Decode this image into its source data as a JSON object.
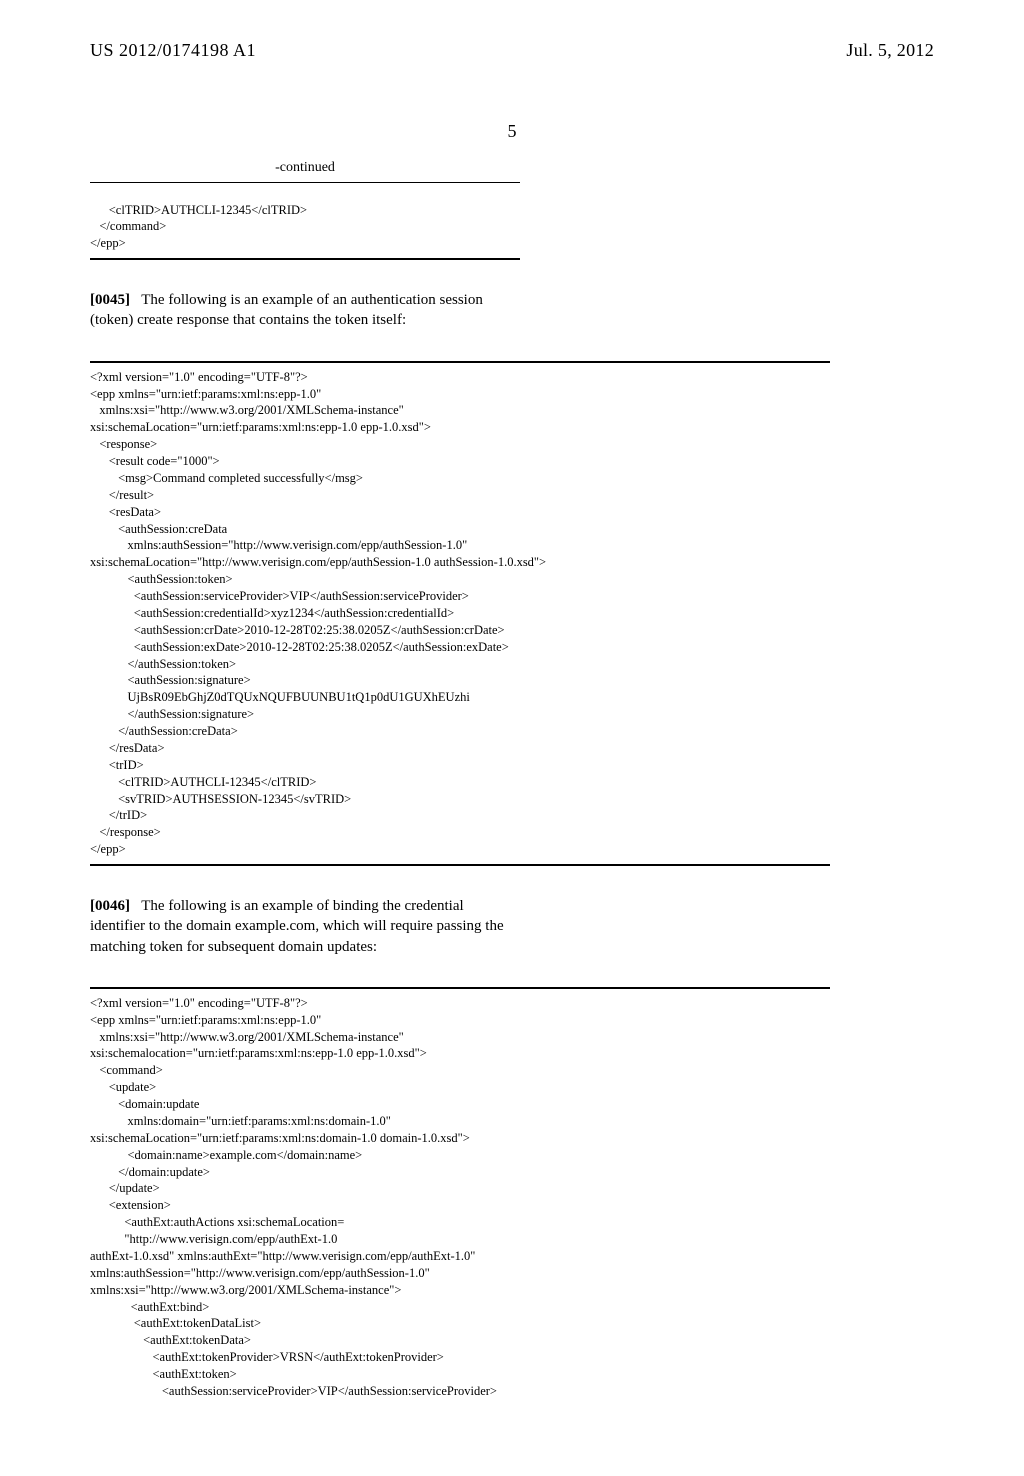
{
  "header": {
    "pub_number": "US 2012/0174198 A1",
    "pub_date": "Jul. 5, 2012"
  },
  "page_number": "5",
  "continued_label": "-continued",
  "code1": "      <clTRID>AUTHCLI-12345</clTRID>\n   </command>\n</epp>",
  "para1": {
    "num": "[0045]",
    "text": "The following is an example of an authentication session (token) create response that contains the token itself:"
  },
  "code2": "<?xml version=\"1.0\" encoding=\"UTF-8\"?>\n<epp xmlns=\"urn:ietf:params:xml:ns:epp-1.0\"\n   xmlns:xsi=\"http://www.w3.org/2001/XMLSchema-instance\"\nxsi:schemaLocation=\"urn:ietf:params:xml:ns:epp-1.0 epp-1.0.xsd\">\n   <response>\n      <result code=\"1000\">\n         <msg>Command completed successfully</msg>\n      </result>\n      <resData>\n         <authSession:creData\n            xmlns:authSession=\"http://www.verisign.com/epp/authSession-1.0\"\nxsi:schemaLocation=\"http://www.verisign.com/epp/authSession-1.0 authSession-1.0.xsd\">\n            <authSession:token>\n              <authSession:serviceProvider>VIP</authSession:serviceProvider>\n              <authSession:credentialId>xyz1234</authSession:credentialId>\n              <authSession:crDate>2010-12-28T02:25:38.0205Z</authSession:crDate>\n              <authSession:exDate>2010-12-28T02:25:38.0205Z</authSession:exDate>\n            </authSession:token>\n            <authSession:signature>\n            UjBsR09EbGhjZ0dTQUxNQUFBUUNBU1tQ1p0dU1GUXhEUzhi\n            </authSession:signature>\n         </authSession:creData>\n      </resData>\n      <trID>\n         <clTRID>AUTHCLI-12345</clTRID>\n         <svTRID>AUTHSESSION-12345</svTRID>\n      </trID>\n   </response>\n</epp>",
  "para2": {
    "num": "[0046]",
    "text": "The following is an example of binding the credential identifier to the domain example.com, which will require passing the matching token for subsequent domain updates:"
  },
  "code3": "<?xml version=\"1.0\" encoding=\"UTF-8\"?>\n<epp xmlns=\"urn:ietf:params:xml:ns:epp-1.0\"\n   xmlns:xsi=\"http://www.w3.org/2001/XMLSchema-instance\"\nxsi:schemalocation=\"urn:ietf:params:xml:ns:epp-1.0 epp-1.0.xsd\">\n   <command>\n      <update>\n         <domain:update\n            xmlns:domain=\"urn:ietf:params:xml:ns:domain-1.0\"\nxsi:schemaLocation=\"urn:ietf:params:xml:ns:domain-1.0 domain-1.0.xsd\">\n            <domain:name>example.com</domain:name>\n         </domain:update>\n      </update>\n      <extension>\n           <authExt:authActions xsi:schemaLocation=\n           \"http://www.verisign.com/epp/authExt-1.0\nauthExt-1.0.xsd\" xmlns:authExt=\"http://www.verisign.com/epp/authExt-1.0\"\nxmlns:authSession=\"http://www.verisign.com/epp/authSession-1.0\"\nxmlns:xsi=\"http://www.w3.org/2001/XMLSchema-instance\">\n             <authExt:bind>\n              <authExt:tokenDataList>\n                 <authExt:tokenData>\n                    <authExt:tokenProvider>VRSN</authExt:tokenProvider>\n                    <authExt:token>\n                       <authSession:serviceProvider>VIP</authSession:serviceProvider>"
}
